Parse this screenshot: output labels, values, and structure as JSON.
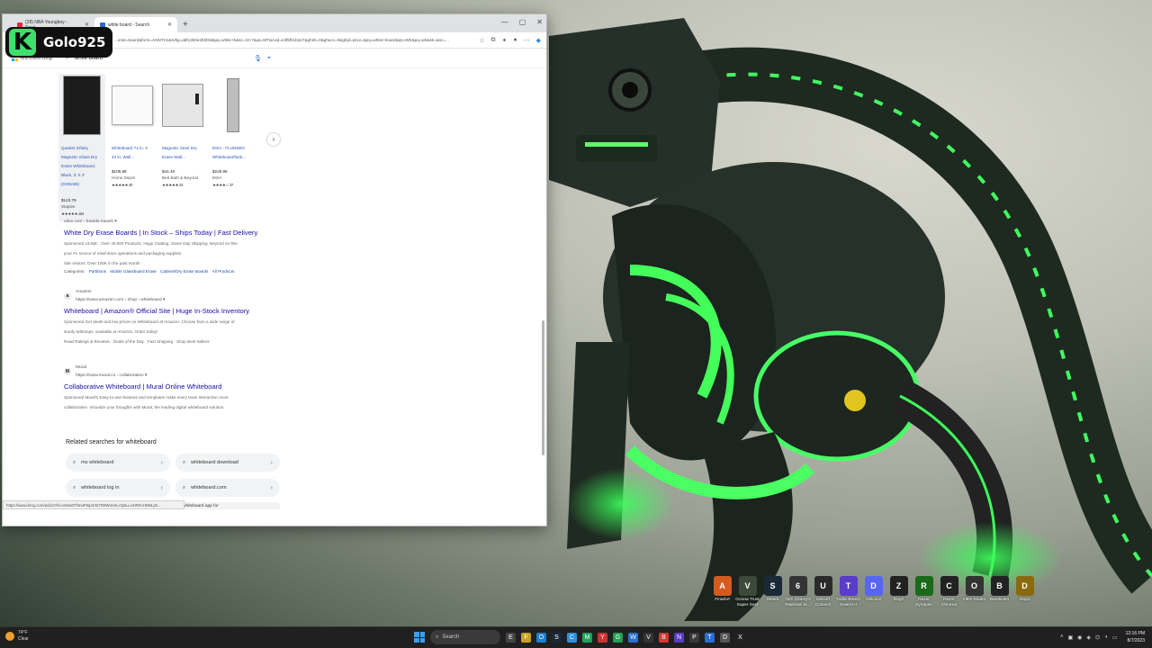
{
  "overlay": {
    "badge_letter": "K",
    "name": "Golo925"
  },
  "browser": {
    "tabs": [
      {
        "label": "(28) NBA Youngboy - Rewi...",
        "favicon_color": "#e03030",
        "active": false
      },
      {
        "label": "white board - Search",
        "favicon_color": "#2b6ad1",
        "active": true
      }
    ],
    "new_tab": "+",
    "url": "...ente=board&form=ANNTH1&refig=a8f13b0e2b5f4d&pq=white+b&sc=10-7&qs=MT&cvid=e3f5fb1b2e7&ghsh=0&ghacc=0&ghpl=&rvv=&pq=white+board&qs=WE&pq=wh&sk=&sc=...",
    "bing": {
      "logo_text": "Microsoft Bing",
      "query": "white board"
    },
    "products": [
      {
        "title": "Quartet Infinity Magnetic Glass Dry Erase Whiteboard, Black, 3' X 2' (G3024B)",
        "price": "$143.79",
        "store": "Staples",
        "stars": "★★★★★ 164"
      },
      {
        "title": "Whiteboard 72 in. X 43 in. Wall...",
        "price": "$109.98",
        "store": "Home Depot",
        "stars": "★★★★★ 40"
      },
      {
        "title": "Magnetic Steel Dry Erase Wall...",
        "price": "$44.49",
        "store": "Bed Bath & Beyond",
        "stars": "★★★★★ 23"
      },
      {
        "title": "IKEA - FLUNSEN Whiteboard/Noti...",
        "price": "$229.99",
        "store": "IKEA",
        "stars": "★★★★☆ 37"
      }
    ],
    "results": {
      "uline": {
        "source": "uline.com › boards-easels ▾",
        "title": "White Dry Erase Boards | In Stock – Ships Today | Fast Delivery",
        "snippet1": "Sponsored  ULINE · Over 40,000 Products. Huge Catalog. Same Day Shipping. Beyond on-line",
        "snippet2": "your #1 source of retail store operations and packaging supplies.",
        "visitors": "Site visitors: Over 100K in the past month",
        "categories_label": "Categories:",
        "categories": [
          "Partitions",
          "Mobile Glassboard Erase",
          "Cabinet/Dry Erase Boards",
          "All Products"
        ]
      },
      "amazon": {
        "name": "Amazon",
        "badge": "a",
        "source": "https://www.amazon.com › shop › whiteboard ▾",
        "title": "Whiteboard | Amazon® Official Site | Huge In-Stock Inventory",
        "snippet1": "Sponsored  Get deals and low prices on Whiteboard at Amazon. Choose from a wide range of",
        "snippet2": "sturdy tabletops, available at Amazon. Order today!",
        "snippet3": "Read Ratings & Reviews · Deals of the Day · Fast Shipping · Shop Best Sellers"
      },
      "mural": {
        "name": "Mural",
        "badge": "M",
        "source": "https://www.mural.co › collaboration ▾",
        "title": "Collaborative Whiteboard | Mural Online Whiteboard",
        "snippet1": "Sponsored  Mural's Easy-to-use features and templates make every team interaction more",
        "snippet2": "collaborative. Visualize your thoughts with Mural, the leading digital whiteboard solution."
      }
    },
    "related": {
      "heading": "Related searches for whiteboard",
      "chips": [
        "ms whiteboard",
        "whiteboard download",
        "whiteboard log in",
        "whiteboard.com",
        "whiteboard app for"
      ]
    },
    "status_url": "https://www.bing.com/aclick?ld=e8Jw6Tf4rwF8q4Vt27R0Wmv9=rQ&u=aHR0cHM6Ly9...",
    "window_controls": [
      "—",
      "▢",
      "✕"
    ]
  },
  "desktop_icons": [
    {
      "label": "FinalArt",
      "glyph": "A",
      "color": "#d45a1e"
    },
    {
      "label": "Gonna Trust Super Sect",
      "glyph": "V",
      "color": "#3c4a3a"
    },
    {
      "label": "Steam",
      "glyph": "S",
      "color": "#1b2838"
    },
    {
      "label": "Tom Clancy's Rainbow Si...",
      "glyph": "6",
      "color": "#333333"
    },
    {
      "label": "Ubisoft Connect",
      "glyph": "U",
      "color": "#2a2a2a"
    },
    {
      "label": "Turtle Beach Swarm II",
      "glyph": "T",
      "color": "#5a3cc8"
    },
    {
      "label": "Discord",
      "glyph": "D",
      "color": "#5865f2"
    },
    {
      "label": "DayZ",
      "glyph": "Z",
      "color": "#222222"
    },
    {
      "label": "Razer Synapse",
      "glyph": "R",
      "color": "#1a6a1a"
    },
    {
      "label": "Razer Chroma",
      "glyph": "C",
      "color": "#222222"
    },
    {
      "label": "OBS Studio",
      "glyph": "O",
      "color": "#333333"
    },
    {
      "label": "Bandicam",
      "glyph": "B",
      "color": "#222222"
    },
    {
      "label": "DayS",
      "glyph": "D",
      "color": "#8a6a10"
    }
  ],
  "taskbar": {
    "weather_temp": "74°F",
    "weather_desc": "Clear",
    "search_placeholder": "Search",
    "apps": [
      "E",
      "F",
      "O",
      "S",
      "C",
      "M",
      "Y",
      "G",
      "W",
      "V",
      "B",
      "N",
      "P",
      "T",
      "D",
      "X"
    ],
    "time": "12:16 PM",
    "date": "8/7/2023"
  }
}
